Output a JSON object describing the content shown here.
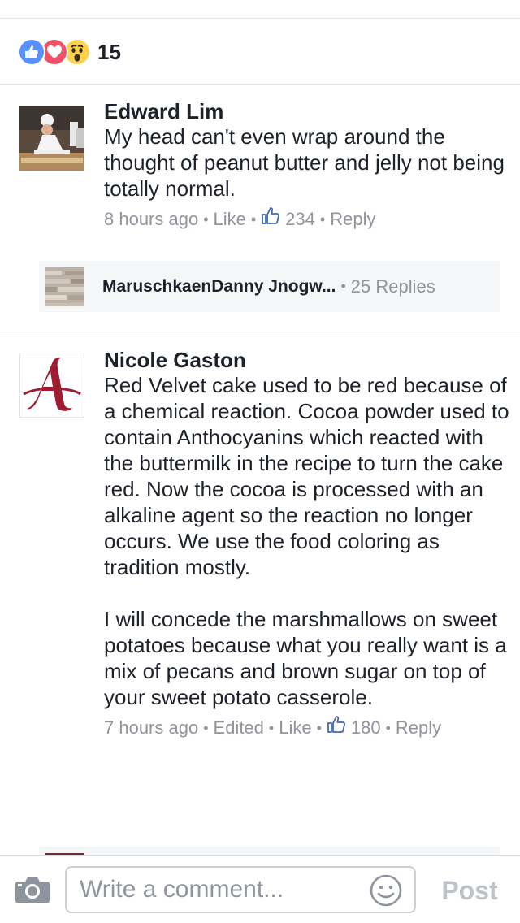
{
  "reactions": {
    "types": [
      "like",
      "love",
      "wow"
    ],
    "count": "15",
    "colors": {
      "like": "#5890ff",
      "love": "#f25268",
      "wow": "#fcd24c"
    }
  },
  "comments": [
    {
      "author": "Edward Lim",
      "text": "My head can't even wrap around the thought of peanut butter and jelly not being totally normal.",
      "time": "8 hours ago",
      "like_label": "Like",
      "like_count": "234",
      "reply_label": "Reply",
      "replies": {
        "names": "MaruschkaenDanny Jnogw...",
        "count_label": "25 Replies"
      }
    },
    {
      "author": "Nicole Gaston",
      "text": "Red Velvet cake used to be red because of a chemical reaction. Cocoa powder used to contain Anthocyanins which reacted with the buttermilk in the recipe to turn the cake red.  Now the cocoa is processed with an alkaline agent so the reaction no longer occurs.  We use the food coloring as tradition mostly.\n\nI will concede the marshmallows on sweet potatoes because what you really want is a mix of pecans and brown sugar on top of your sweet potato casserole.",
      "time": "7 hours ago",
      "edited_label": "Edited",
      "like_label": "Like",
      "like_count": "180",
      "reply_label": "Reply"
    }
  ],
  "composer": {
    "placeholder": "Write a comment...",
    "post_label": "Post"
  },
  "colors": {
    "meta_gray": "#90949c",
    "text": "#1d2129",
    "divider": "#e3e4e8",
    "post_disabled": "#bec3c9",
    "alabama_crimson": "#9e1b32"
  }
}
